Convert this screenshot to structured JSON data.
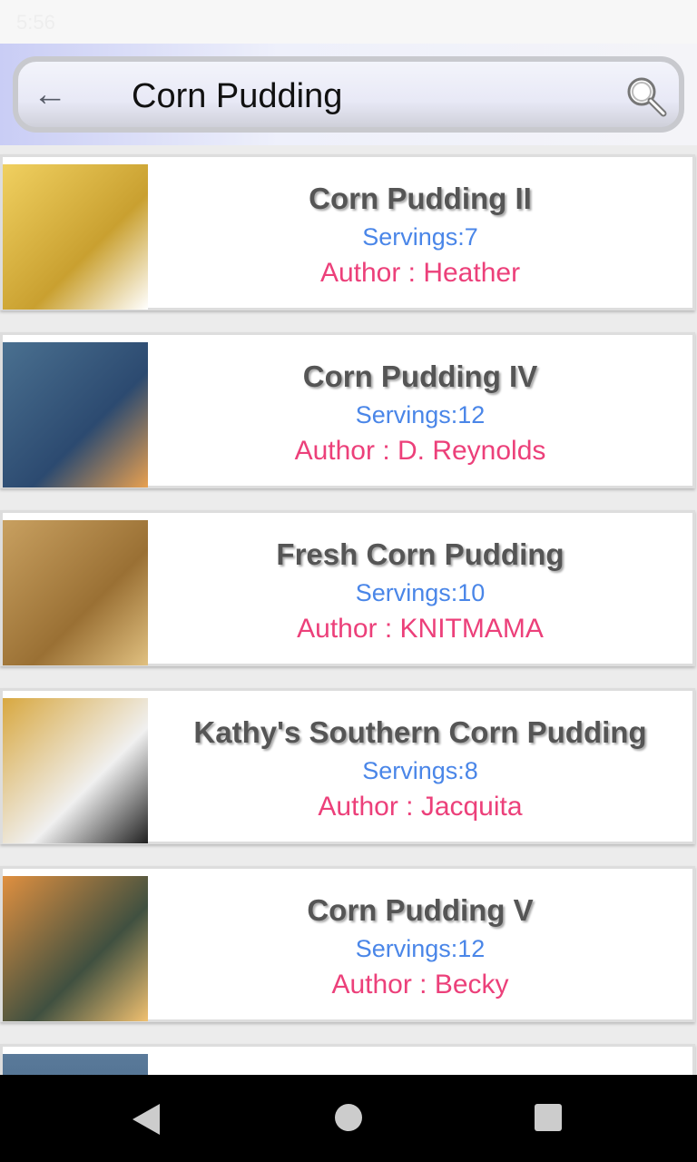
{
  "status_bar": {
    "time": "5:56"
  },
  "header": {
    "title": "Corn Pudding",
    "back_icon": "arrow-left-icon",
    "search_icon": "magnifier-icon"
  },
  "recipes": [
    {
      "name": "Corn Pudding II",
      "servings": "Servings:7",
      "author": "Author : Heather",
      "thumb": [
        "#f0d060",
        "#c9a030",
        "#fff"
      ]
    },
    {
      "name": "Corn Pudding IV",
      "servings": "Servings:12",
      "author": "Author : D. Reynolds",
      "thumb": [
        "#4a7090",
        "#2c4a70",
        "#e8a050"
      ]
    },
    {
      "name": "Fresh Corn Pudding",
      "servings": "Servings:10",
      "author": "Author : KNITMAMA",
      "thumb": [
        "#c8a060",
        "#9a7034",
        "#e0c080"
      ]
    },
    {
      "name": "Kathy's Southern Corn Pudding",
      "servings": "Servings:8",
      "author": "Author : Jacquita",
      "thumb": [
        "#d8a840",
        "#f0f0f0",
        "#202020"
      ]
    },
    {
      "name": "Corn Pudding V",
      "servings": "Servings:12",
      "author": "Author : Becky",
      "thumb": [
        "#e09040",
        "#405040",
        "#f0c070"
      ]
    }
  ],
  "colors": {
    "servings": "#4a86e8",
    "author": "#ec407a",
    "title": "#555555"
  },
  "nav": {
    "back": "triangle-back-icon",
    "home": "circle-home-icon",
    "recents": "square-recents-icon"
  }
}
